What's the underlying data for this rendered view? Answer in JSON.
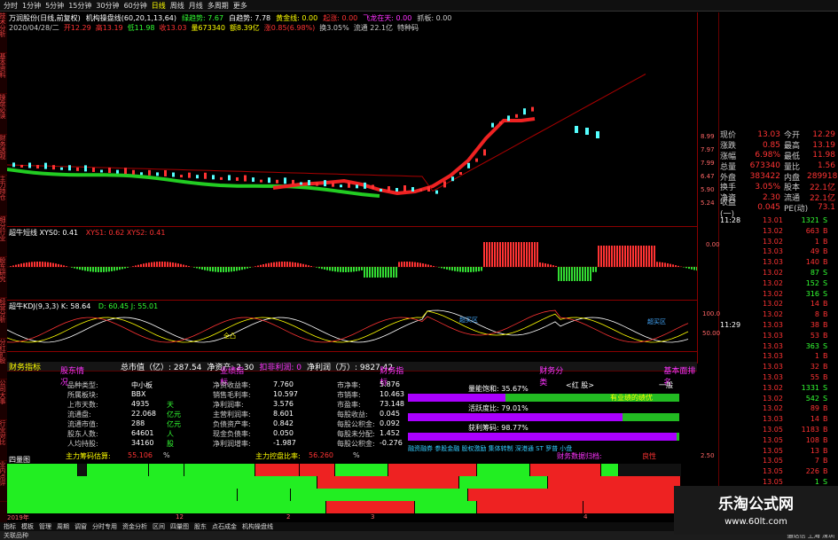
{
  "toolbar": {
    "items": [
      "分时",
      "1分钟",
      "5分钟",
      "15分钟",
      "30分钟",
      "60分钟",
      "日线",
      "周线",
      "月线",
      "多周期",
      "更多"
    ],
    "selected": "日线"
  },
  "left_tabs": [
    "技术分析",
    "基本资料",
    "操盘必读",
    "财务透视",
    "主力持仓",
    "细分行业",
    "股东研究",
    "经营分析",
    "分红扩股",
    "公司大事",
    "行业对比",
    "业内点评"
  ],
  "header": {
    "stock": "万润股份(日线,前复权)",
    "indicator": "机构操盘线(60,20,1,13,64)",
    "vals": [
      {
        "t": "绿趋势: 7.67",
        "c": "#3f3"
      },
      {
        "t": "白趋势: 7.78",
        "c": "#fff"
      },
      {
        "t": "黄金线: 0.00",
        "c": "#ff0"
      },
      {
        "t": "起涨: 0.00",
        "c": "#f33"
      },
      {
        "t": "飞龙在天: 0.00",
        "c": "#f3f"
      },
      {
        "t": "抓板: 0.00",
        "c": "#ccc"
      }
    ],
    "line2": [
      {
        "t": "2020/04/28/二",
        "c": "#ccc"
      },
      {
        "t": "开12.29",
        "c": "#f33"
      },
      {
        "t": "高13.19",
        "c": "#f33"
      },
      {
        "t": "低11.98",
        "c": "#3f3"
      },
      {
        "t": "收13.03",
        "c": "#f33"
      },
      {
        "t": "量673340",
        "c": "#ff0"
      },
      {
        "t": "额8.39亿",
        "c": "#ff0"
      },
      {
        "t": "涨0.85(6.98%)",
        "c": "#f33"
      },
      {
        "t": "换3.05%",
        "c": "#ccc"
      },
      {
        "t": "流通 22.1亿",
        "c": "#ccc"
      },
      {
        "t": "特种码",
        "c": "#ccc"
      }
    ]
  },
  "price_axis": [
    "8.99",
    "7.97",
    "7.99",
    "6.47",
    "5.90",
    "5.24"
  ],
  "osc1": {
    "label": "超牛短线 XYS0: 0.41",
    "extra": "XYS1: 0.62  XYS2: 0.41",
    "axis": "0.00"
  },
  "osc2": {
    "label": "超牛KDJ(9,3,3) K: 58.64",
    "extra": "D: 60.45  J: 55.01",
    "axis_top": "100.0",
    "axis_mid": "50.00",
    "tag1": "超买区",
    "tag2": "超买区",
    "tag3": "全凸"
  },
  "quote": {
    "rows": [
      [
        "现价",
        "13.03",
        "今开",
        "12.29"
      ],
      [
        "涨跌",
        "0.85",
        "最高",
        "13.19"
      ],
      [
        "涨幅",
        "6.98%",
        "最低",
        "11.98"
      ],
      [
        "总量",
        "673340",
        "量比",
        "1.56"
      ],
      [
        "外盘",
        "383422",
        "内盘",
        "289918"
      ],
      [
        "换手",
        "3.05%",
        "股本",
        "22.1亿"
      ],
      [
        "净资",
        "2.30",
        "流通",
        "22.1亿"
      ],
      [
        "收益(一)",
        "0.045",
        "PE(动)",
        "73.1"
      ]
    ],
    "time1": "11:28",
    "time2": "11:29",
    "ticks": [
      [
        "13.01",
        "1321",
        "S"
      ],
      [
        "13.02",
        "663",
        "B"
      ],
      [
        "13.02",
        "1",
        "B"
      ],
      [
        "13.03",
        "49",
        "B"
      ],
      [
        "13.03",
        "140",
        "B"
      ],
      [
        "13.02",
        "87",
        "S"
      ],
      [
        "13.02",
        "152",
        "S"
      ],
      [
        "13.02",
        "316",
        "S"
      ],
      [
        "13.02",
        "14",
        "B"
      ],
      [
        "13.02",
        "8",
        "B"
      ],
      [
        "13.03",
        "38",
        "B"
      ],
      [
        "13.03",
        "53",
        "B"
      ],
      [
        "13.03",
        "363",
        "S"
      ],
      [
        "13.03",
        "1",
        "B"
      ],
      [
        "13.03",
        "32",
        "B"
      ],
      [
        "13.03",
        "55",
        "B"
      ],
      [
        "13.02",
        "1331",
        "S"
      ],
      [
        "13.02",
        "542",
        "S"
      ],
      [
        "13.02",
        "89",
        "B"
      ],
      [
        "13.03",
        "14",
        "B"
      ],
      [
        "13.05",
        "1183",
        "B"
      ],
      [
        "13.05",
        "108",
        "B"
      ],
      [
        "13.05",
        "13",
        "B"
      ],
      [
        "13.05",
        "7",
        "B"
      ],
      [
        "13.05",
        "226",
        "B"
      ],
      [
        "13.05",
        "1",
        "S"
      ],
      [
        "13.05",
        "5",
        "B"
      ],
      [
        "13.05",
        "43",
        "B"
      ]
    ]
  },
  "finance": {
    "title": "财务指标",
    "total": "总市值（亿）: 287.54",
    "netasset": "净资产: 2.30",
    "growth": "扣非利润: 0",
    "netprofit": "净利润（万）: 9827.42",
    "sections": [
      "股东情况",
      "业绩指标",
      "财务指标",
      "财务分类",
      "基本面排名"
    ],
    "col1": [
      [
        "品种类型:",
        "中小板"
      ],
      [
        "所属板块:",
        "BBX"
      ],
      [
        "上市天数:",
        "4935",
        "天"
      ],
      [
        "流通盘:",
        "22.068",
        "亿元"
      ],
      [
        "流通市值:",
        "288",
        "亿元"
      ],
      [
        "股东人数:",
        "64601",
        "人"
      ],
      [
        "人均持股:",
        "34160",
        "股"
      ]
    ],
    "col2": [
      [
        "净资收益率:",
        "7.760"
      ],
      [
        "销售毛利率:",
        "10.597"
      ],
      [
        "净利润率:",
        "3.576"
      ],
      [
        "主营利润率:",
        "8.601"
      ],
      [
        "负债资产率:",
        "0.842"
      ],
      [
        "现金负债率:",
        "0.050"
      ],
      [
        "净利润增率:",
        "-1.987"
      ]
    ],
    "col3": [
      [
        "市净率:",
        "5.876"
      ],
      [
        "市销率:",
        "10.463"
      ],
      [
        "市盈率:",
        "73.148"
      ],
      [
        "每股收益:",
        "0.045"
      ],
      [
        "每股公积金:",
        "0.092"
      ],
      [
        "每股未分配:",
        "1.452"
      ],
      [
        "每股公积金:",
        "-0.276"
      ]
    ],
    "right_labels": [
      "量能饱和: 35.67%",
      "活跃度比: 79.01%",
      "获利筹码: 98.77%"
    ],
    "right_tag": "有业绩的绩优",
    "right_note": "融资融券 参股金融 股权激励 集体转制 深港通 ST 罗普 小盘",
    "class": "<红 股>",
    "rank": "一般",
    "footer1": "主力筹码估算:",
    "footer1v": "55.106",
    "footer2": "主力控盘比率:",
    "footer2v": "56.260",
    "footer3": "财务数据归档:",
    "footer3v": "良性",
    "pct": "%"
  },
  "sectors": {
    "title": "四量图",
    "axis": "2.50",
    "x_labels": [
      "2019年",
      "12",
      "2",
      "3",
      "4"
    ]
  },
  "bottom_tabs": [
    "指标",
    "模板",
    "管理",
    "周期",
    "调窗",
    "分时专用",
    "资金分析",
    "区间",
    "四量图",
    "股东",
    "点石成金",
    "机构操盘线"
  ],
  "status": {
    "left": "关联品种",
    "right": "通达信 上海 深圳"
  },
  "watermark": {
    "line1": "乐淘公式网",
    "line2": "www.60lt.com"
  },
  "colors": {
    "up": "#ff3333",
    "down": "#33ff33",
    "grid": "#8b0000"
  }
}
